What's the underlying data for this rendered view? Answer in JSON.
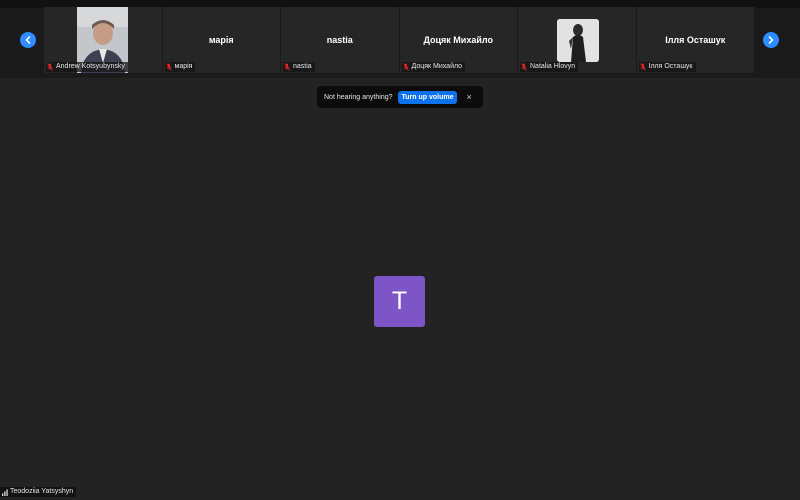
{
  "gallery": {
    "tiles": [
      {
        "display": "",
        "label": "Andrew Kotsyubynsky",
        "has_video": true
      },
      {
        "display": "марія",
        "label": "марія",
        "has_video": false
      },
      {
        "display": "nastia",
        "label": "nastia",
        "has_video": false
      },
      {
        "display": "Доцяк Михайло",
        "label": "Доцяк Михайло",
        "has_video": false
      },
      {
        "display": "",
        "label": "Natalia Hlovyn",
        "has_video": true
      },
      {
        "display": "Ілля Осташук",
        "label": "Ілля Осташук",
        "has_video": false
      }
    ]
  },
  "notification": {
    "message": "Not hearing anything?",
    "button": "Turn up volume",
    "close": "×"
  },
  "speaker": {
    "initial": "T",
    "name": "Teodoziia Yatsyshyn",
    "avatar_color": "#7d55c7"
  },
  "colors": {
    "accent": "#2d8cff",
    "button": "#0e72ed",
    "background": "#232323"
  }
}
